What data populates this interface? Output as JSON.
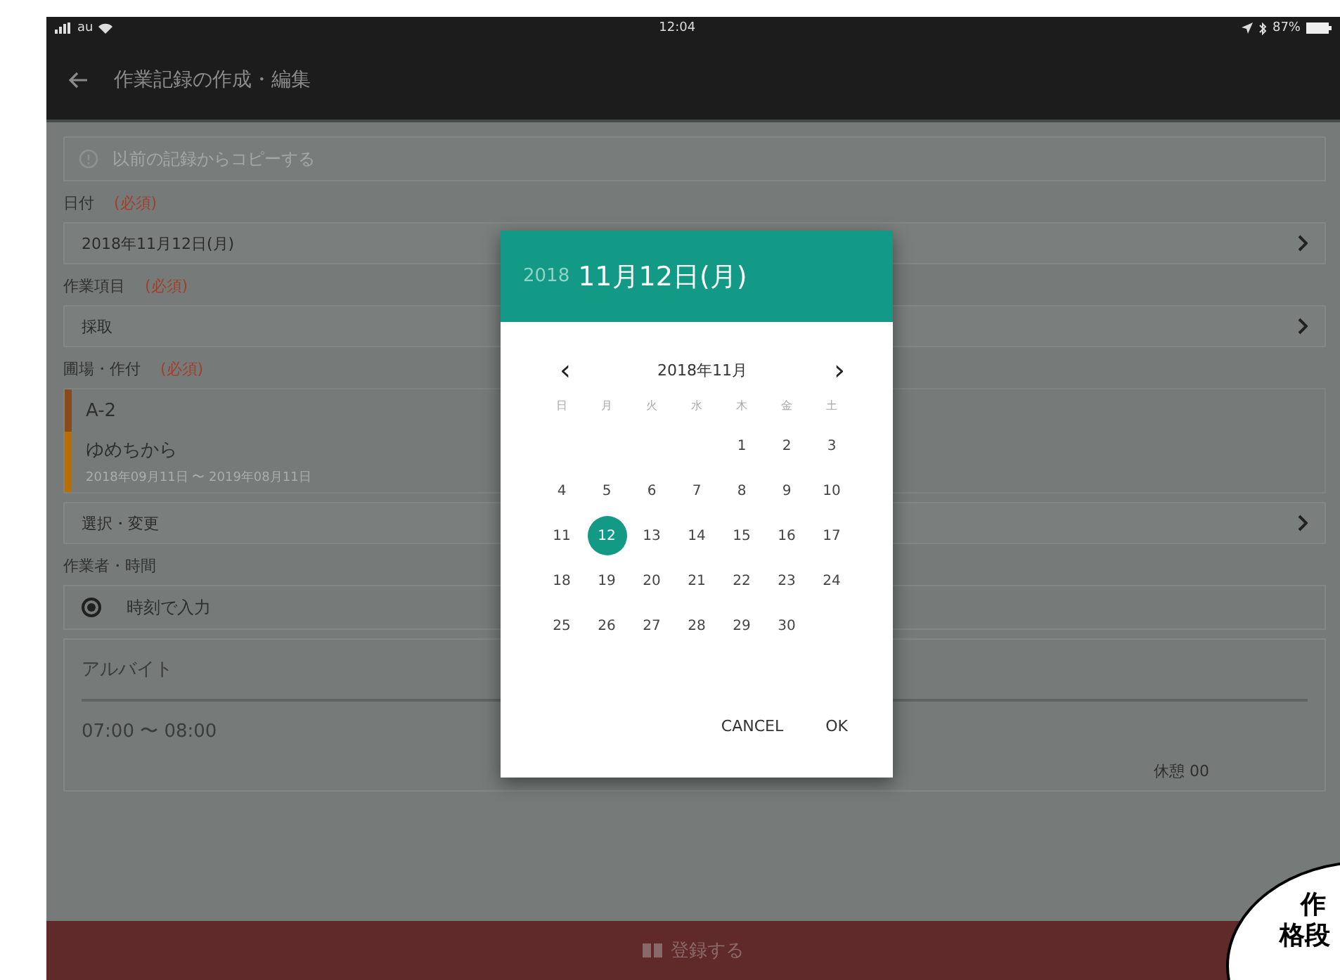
{
  "status_bar": {
    "carrier": "au",
    "time": "12:04",
    "battery": "87%"
  },
  "app_bar": {
    "title": "作業記録の作成・編集"
  },
  "copy_action": {
    "label": "以前の記録からコピーする"
  },
  "sections": [
    {
      "kind": "select",
      "label": "日付",
      "required": "(必須)",
      "value": "2018年11月12日(月)"
    },
    {
      "kind": "select",
      "label": "作業項目",
      "required": "(必須)",
      "value": "採取"
    },
    {
      "kind": "fields",
      "label": "圃場・作付",
      "required": "(必須)",
      "entries": [
        {
          "name": "A-2",
          "color": "#8a4a1c"
        },
        {
          "name": "ゆめちから",
          "sub": "2018年09月11日 〜 2019年08月11日",
          "color": "#b86e08"
        }
      ],
      "value": "選択・変更"
    },
    {
      "kind": "workers",
      "label": "作業者・時間",
      "radio": {
        "label": "時刻で入力",
        "checked": true
      },
      "worker": "アルバイト",
      "time": "07:00 〜 08:00",
      "break": "休憩 00"
    }
  ],
  "submit": {
    "label": "登録する"
  },
  "dialog": {
    "year": "2018",
    "date": "11月12日(月)",
    "month": "2018年11月",
    "prev": "‹",
    "next": "›",
    "weekdays": [
      "日",
      "月",
      "火",
      "水",
      "木",
      "金",
      "土"
    ],
    "weeks": [
      [
        {
          "day": "1",
          "selected": false
        },
        {
          "day": "2",
          "selected": false
        },
        {
          "day": "3",
          "selected": false
        }
      ],
      [
        {
          "day": "4",
          "selected": false
        },
        {
          "day": "5",
          "selected": false
        },
        {
          "day": "6",
          "selected": false
        },
        {
          "day": "7",
          "selected": false
        },
        {
          "day": "8",
          "selected": false
        },
        {
          "day": "9",
          "selected": false
        },
        {
          "day": "10",
          "selected": false
        }
      ],
      [
        {
          "day": "11",
          "selected": false
        },
        {
          "day": "12",
          "selected": true
        },
        {
          "day": "13",
          "selected": false
        },
        {
          "day": "14",
          "selected": false
        },
        {
          "day": "15",
          "selected": false
        },
        {
          "day": "16",
          "selected": false
        },
        {
          "day": "17",
          "selected": false
        }
      ],
      [
        {
          "day": "18",
          "selected": false
        },
        {
          "day": "19",
          "selected": false
        },
        {
          "day": "20",
          "selected": false
        },
        {
          "day": "21",
          "selected": false
        },
        {
          "day": "22",
          "selected": false
        },
        {
          "day": "23",
          "selected": false
        },
        {
          "day": "24",
          "selected": false
        }
      ],
      [
        {
          "day": "25",
          "selected": false
        },
        {
          "day": "26",
          "selected": false
        },
        {
          "day": "27",
          "selected": false
        },
        {
          "day": "28",
          "selected": false
        },
        {
          "day": "29",
          "selected": false
        },
        {
          "day": "30",
          "selected": false
        }
      ]
    ],
    "buttons": [
      "CANCEL",
      "OK"
    ]
  },
  "callout": {
    "lines": [
      "作",
      "格段"
    ]
  }
}
